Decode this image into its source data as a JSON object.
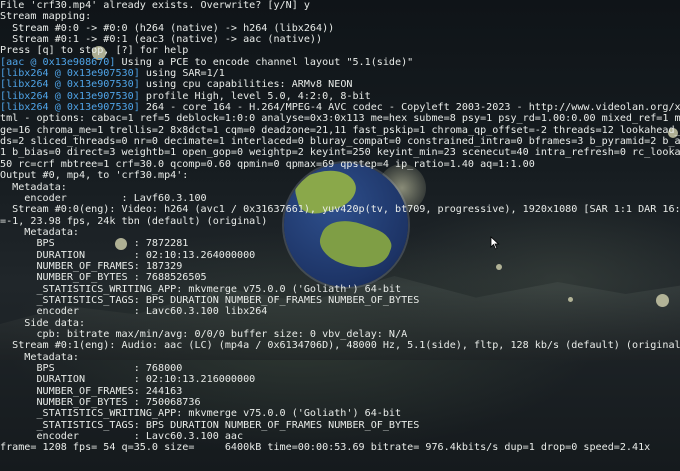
{
  "terminal": {
    "lines": [
      {
        "tag": "",
        "text": "File 'crf30.mp4' already exists. Overwrite? [y/N] y"
      },
      {
        "tag": "",
        "text": "Stream mapping:"
      },
      {
        "tag": "",
        "text": "  Stream #0:0 -> #0:0 (h264 (native) -> h264 (libx264))"
      },
      {
        "tag": "",
        "text": "  Stream #0:1 -> #0:1 (eac3 (native) -> aac (native))"
      },
      {
        "tag": "",
        "text": "Press [q] to stop, [?] for help"
      },
      {
        "tag": "[aac @ 0x13e908670]",
        "text": " Using a PCE to encode channel layout \"5.1(side)\""
      },
      {
        "tag": "[libx264 @ 0x13e907530]",
        "text": " using SAR=1/1"
      },
      {
        "tag": "[libx264 @ 0x13e907530]",
        "text": " using cpu capabilities: ARMv8 NEON"
      },
      {
        "tag": "[libx264 @ 0x13e907530]",
        "text": " profile High, level 5.0, 4:2:0, 8-bit"
      },
      {
        "tag": "[libx264 @ 0x13e907530]",
        "text": " 264 - core 164 - H.264/MPEG-4 AVC codec - Copyleft 2003-2023 - http://www.videolan.org/x264"
      },
      {
        "tag": "",
        "text": "tml - options: cabac=1 ref=5 deblock=1:0:0 analyse=0x3:0x113 me=hex subme=8 psy=1 psy_rd=1.00:0.00 mixed_ref=1 me_ra"
      },
      {
        "tag": "",
        "text": "ge=16 chroma_me=1 trellis=2 8x8dct=1 cqm=0 deadzone=21,11 fast_pskip=1 chroma_qp_offset=-2 threads=12 lookahead_thr"
      },
      {
        "tag": "",
        "text": "ds=2 sliced_threads=0 nr=0 decimate=1 interlaced=0 bluray_compat=0 constrained_intra=0 bframes=3 b_pyramid=2 b_adapt"
      },
      {
        "tag": "",
        "text": "1 b_bias=0 direct=3 weightb=1 open_gop=0 weightp=2 keyint=250 keyint_min=23 scenecut=40 intra_refresh=0 rc_lookahea"
      },
      {
        "tag": "",
        "text": "50 rc=crf mbtree=1 crf=30.0 qcomp=0.60 qpmin=0 qpmax=69 qpstep=4 ip_ratio=1.40 aq=1:1.00"
      },
      {
        "tag": "",
        "text": "Output #0, mp4, to 'crf30.mp4':"
      },
      {
        "tag": "",
        "text": "  Metadata:"
      },
      {
        "tag": "",
        "text": "    encoder         : Lavf60.3.100"
      },
      {
        "tag": "",
        "text": "  Stream #0:0(eng): Video: h264 (avc1 / 0x31637661), yuv420p(tv, bt709, progressive), 1920x1080 [SAR 1:1 DAR 16:9],"
      },
      {
        "tag": "",
        "text": "=-1, 23.98 fps, 24k tbn (default) (original)"
      },
      {
        "tag": "",
        "text": "    Metadata:"
      },
      {
        "tag": "",
        "text": "      BPS             : 7872281"
      },
      {
        "tag": "",
        "text": "      DURATION        : 02:10:13.264000000"
      },
      {
        "tag": "",
        "text": "      NUMBER_OF_FRAMES: 187329"
      },
      {
        "tag": "",
        "text": "      NUMBER_OF_BYTES : 7688526505"
      },
      {
        "tag": "",
        "text": "      _STATISTICS_WRITING_APP: mkvmerge v75.0.0 ('Goliath') 64-bit"
      },
      {
        "tag": "",
        "text": "      _STATISTICS_TAGS: BPS DURATION NUMBER_OF_FRAMES NUMBER_OF_BYTES"
      },
      {
        "tag": "",
        "text": "      encoder         : Lavc60.3.100 libx264"
      },
      {
        "tag": "",
        "text": "    Side data:"
      },
      {
        "tag": "",
        "text": "      cpb: bitrate max/min/avg: 0/0/0 buffer size: 0 vbv_delay: N/A"
      },
      {
        "tag": "",
        "text": "  Stream #0:1(eng): Audio: aac (LC) (mp4a / 0x6134706D), 48000 Hz, 5.1(side), fltp, 128 kb/s (default) (original)"
      },
      {
        "tag": "",
        "text": "    Metadata:"
      },
      {
        "tag": "",
        "text": "      BPS             : 768000"
      },
      {
        "tag": "",
        "text": "      DURATION        : 02:10:13.216000000"
      },
      {
        "tag": "",
        "text": "      NUMBER_OF_FRAMES: 244163"
      },
      {
        "tag": "",
        "text": "      NUMBER_OF_BYTES : 750068736"
      },
      {
        "tag": "",
        "text": "      _STATISTICS_WRITING_APP: mkvmerge v75.0.0 ('Goliath') 64-bit"
      },
      {
        "tag": "",
        "text": "      _STATISTICS_TAGS: BPS DURATION NUMBER_OF_FRAMES NUMBER_OF_BYTES"
      },
      {
        "tag": "",
        "text": "      encoder         : Lavc60.3.100 aac"
      },
      {
        "tag": "",
        "text": "frame= 1208 fps= 54 q=35.0 size=     6400kB time=00:00:53.69 bitrate= 976.4kbits/s dup=1 drop=0 speed=2.41x"
      }
    ]
  },
  "colors": {
    "text": "#e9ece9",
    "tag": "#4fa4e8",
    "background": "#12161a"
  }
}
